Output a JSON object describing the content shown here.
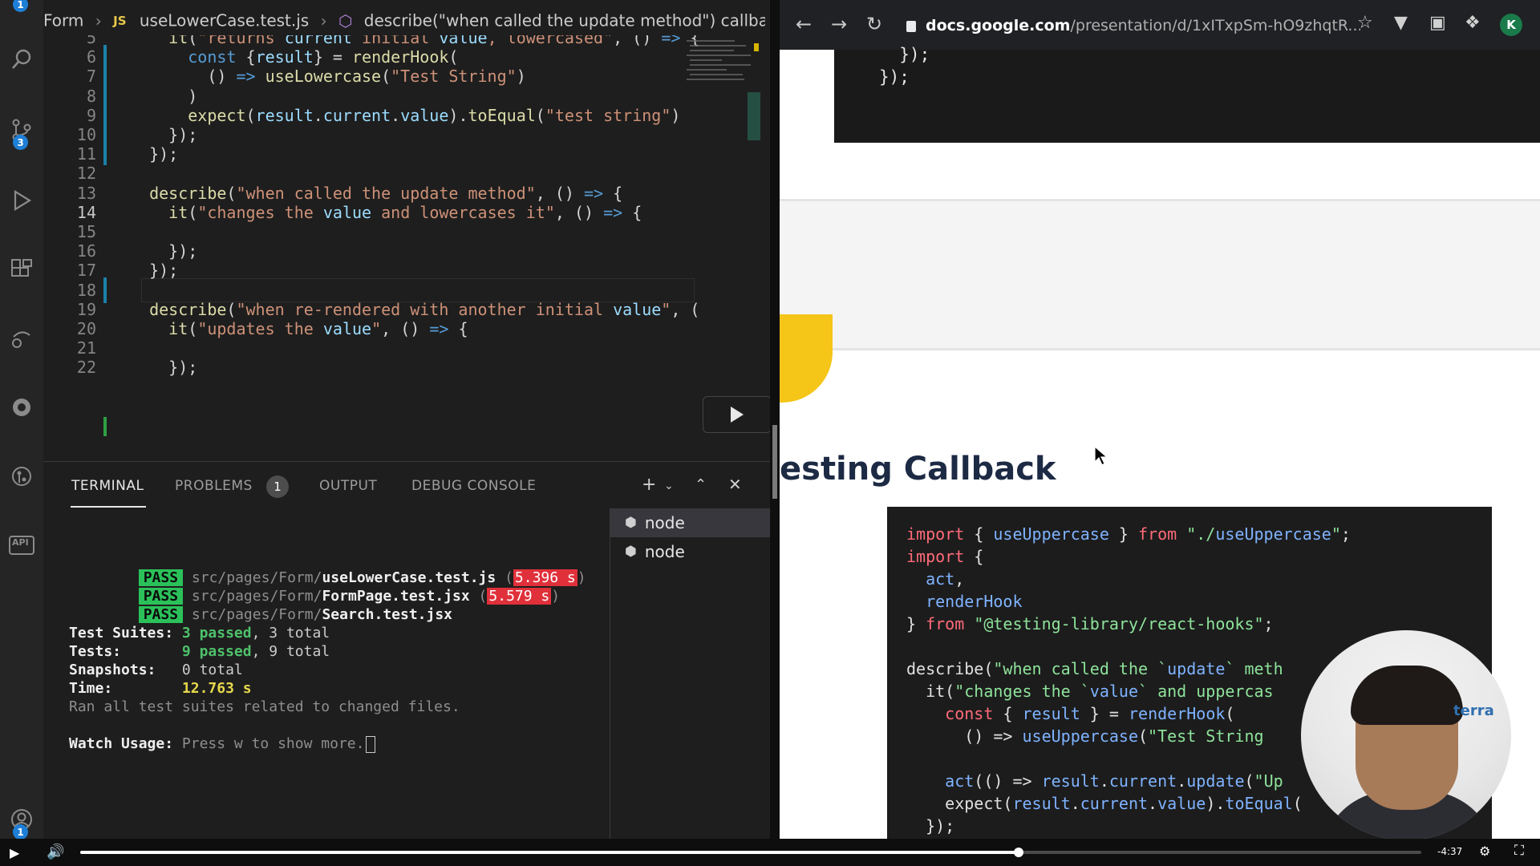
{
  "activity_bar": {
    "badges": {
      "top": "1",
      "source_control": "3",
      "accounts": "1"
    },
    "api_label": "API"
  },
  "breadcrumb": {
    "folder": "Form",
    "file_badge": "JS",
    "file": "useLowerCase.test.js",
    "symbol": "describe(\"when called the update method\") callback"
  },
  "editor": {
    "lines": [
      {
        "n": "5",
        "text": "    it(\"returns current initial value, lowercased\", () => {"
      },
      {
        "n": "6",
        "text": "      const {result} = renderHook("
      },
      {
        "n": "7",
        "text": "        () => useLowercase(\"Test String\")"
      },
      {
        "n": "8",
        "text": "      )"
      },
      {
        "n": "9",
        "text": "      expect(result.current.value).toEqual(\"test string\")"
      },
      {
        "n": "10",
        "text": "    });"
      },
      {
        "n": "11",
        "text": "  });"
      },
      {
        "n": "12",
        "text": ""
      },
      {
        "n": "13",
        "text": "  describe(\"when called the update method\", () => {"
      },
      {
        "n": "14",
        "text": "    it(\"changes the value and lowercases it\", () => {"
      },
      {
        "n": "15",
        "text": ""
      },
      {
        "n": "16",
        "text": "    });"
      },
      {
        "n": "17",
        "text": "  });"
      },
      {
        "n": "18",
        "text": ""
      },
      {
        "n": "19",
        "text": "  describe(\"when re-rendered with another initial value\", ("
      },
      {
        "n": "20",
        "text": "    it(\"updates the value\", () => {"
      },
      {
        "n": "21",
        "text": ""
      },
      {
        "n": "22",
        "text": "    });"
      }
    ],
    "active_line": "14"
  },
  "panel": {
    "tabs": [
      "TERMINAL",
      "PROBLEMS",
      "OUTPUT",
      "DEBUG CONSOLE"
    ],
    "active_tab": "TERMINAL",
    "problems_count": "1",
    "terminals": [
      "node",
      "node"
    ],
    "results": [
      {
        "status": "PASS",
        "dir": "src/pages/Form/",
        "file": "useLowerCase.test.js",
        "time": "5.396 s"
      },
      {
        "status": "PASS",
        "dir": "src/pages/Form/",
        "file": "FormPage.test.jsx",
        "time": "5.579 s"
      },
      {
        "status": "PASS",
        "dir": "src/pages/Form/",
        "file": "Search.test.jsx",
        "time": ""
      }
    ],
    "summary": {
      "suites_label": "Test Suites:",
      "suites_passed": "3 passed",
      "suites_total": ", 3 total",
      "tests_label": "Tests:",
      "tests_passed": "9 passed",
      "tests_total": ", 9 total",
      "snapshots_label": "Snapshots:",
      "snapshots_value": "0 total",
      "time_label": "Time:",
      "time_value": "12.763 s",
      "ran_all": "Ran all test suites related to changed files.",
      "watch_label": "Watch Usage:",
      "watch_text": "Press w to show more."
    }
  },
  "browser": {
    "url_host": "docs.google.com",
    "url_path": "/presentation/d/1xITxpSm-hO9zhqtR...",
    "top_code": [
      "  });",
      "});"
    ],
    "slide_title": "esting Callback",
    "code": [
      "import { useUppercase } from \"./useUppercase\";",
      "import {",
      "  act,",
      "  renderHook",
      "} from \"@testing-library/react-hooks\";",
      "",
      "describe(\"when called the `update` meth",
      "  it(\"changes the `value` and uppercas",
      "    const { result } = renderHook(",
      "      () => useUppercase(\"Test String",
      "",
      "    act(() => result.current.update(\"Up",
      "    expect(result.current.value).toEqual(",
      "  });"
    ],
    "webcam_logo": "terra"
  },
  "video": {
    "time_remaining": "-4:37",
    "progress": 0.7
  }
}
